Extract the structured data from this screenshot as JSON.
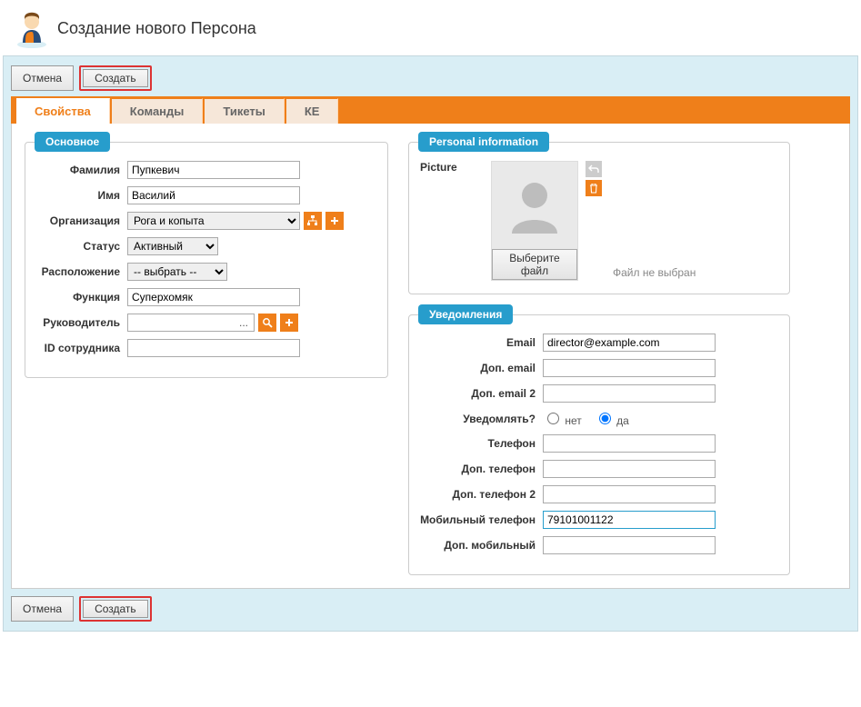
{
  "header": {
    "title": "Создание нового Персона"
  },
  "toolbar": {
    "cancel": "Отмена",
    "create": "Создать"
  },
  "tabs": [
    {
      "label": "Свойства",
      "active": true
    },
    {
      "label": "Команды",
      "active": false
    },
    {
      "label": "Тикеты",
      "active": false
    },
    {
      "label": "КЕ",
      "active": false
    }
  ],
  "main_fs": {
    "legend": "Основное",
    "surname_label": "Фамилия",
    "surname_value": "Пупкевич",
    "name_label": "Имя",
    "name_value": "Василий",
    "org_label": "Организация",
    "org_value": "Рога и копыта",
    "status_label": "Статус",
    "status_value": "Активный",
    "location_label": "Расположение",
    "location_value": "-- выбрать --",
    "function_label": "Функция",
    "function_value": "Суперхомяк",
    "manager_label": "Руководитель",
    "manager_value": "",
    "employee_id_label": "ID сотрудника",
    "employee_id_value": ""
  },
  "personal_fs": {
    "legend": "Personal information",
    "picture_label": "Picture",
    "choose_file_btn": "Выберите файл",
    "no_file_hint": "Файл не выбран"
  },
  "notify_fs": {
    "legend": "Уведомления",
    "email_label": "Email",
    "email_value": "director@example.com",
    "add_email_label": "Доп. email",
    "add_email2_label": "Доп. email 2",
    "notify_label": "Уведомлять?",
    "notify_no": "нет",
    "notify_yes": "да",
    "phone_label": "Телефон",
    "add_phone_label": "Доп. телефон",
    "add_phone2_label": "Доп. телефон 2",
    "mobile_label": "Мобильный телефон",
    "mobile_value": "79101001122",
    "add_mobile_label": "Доп. мобильный"
  }
}
